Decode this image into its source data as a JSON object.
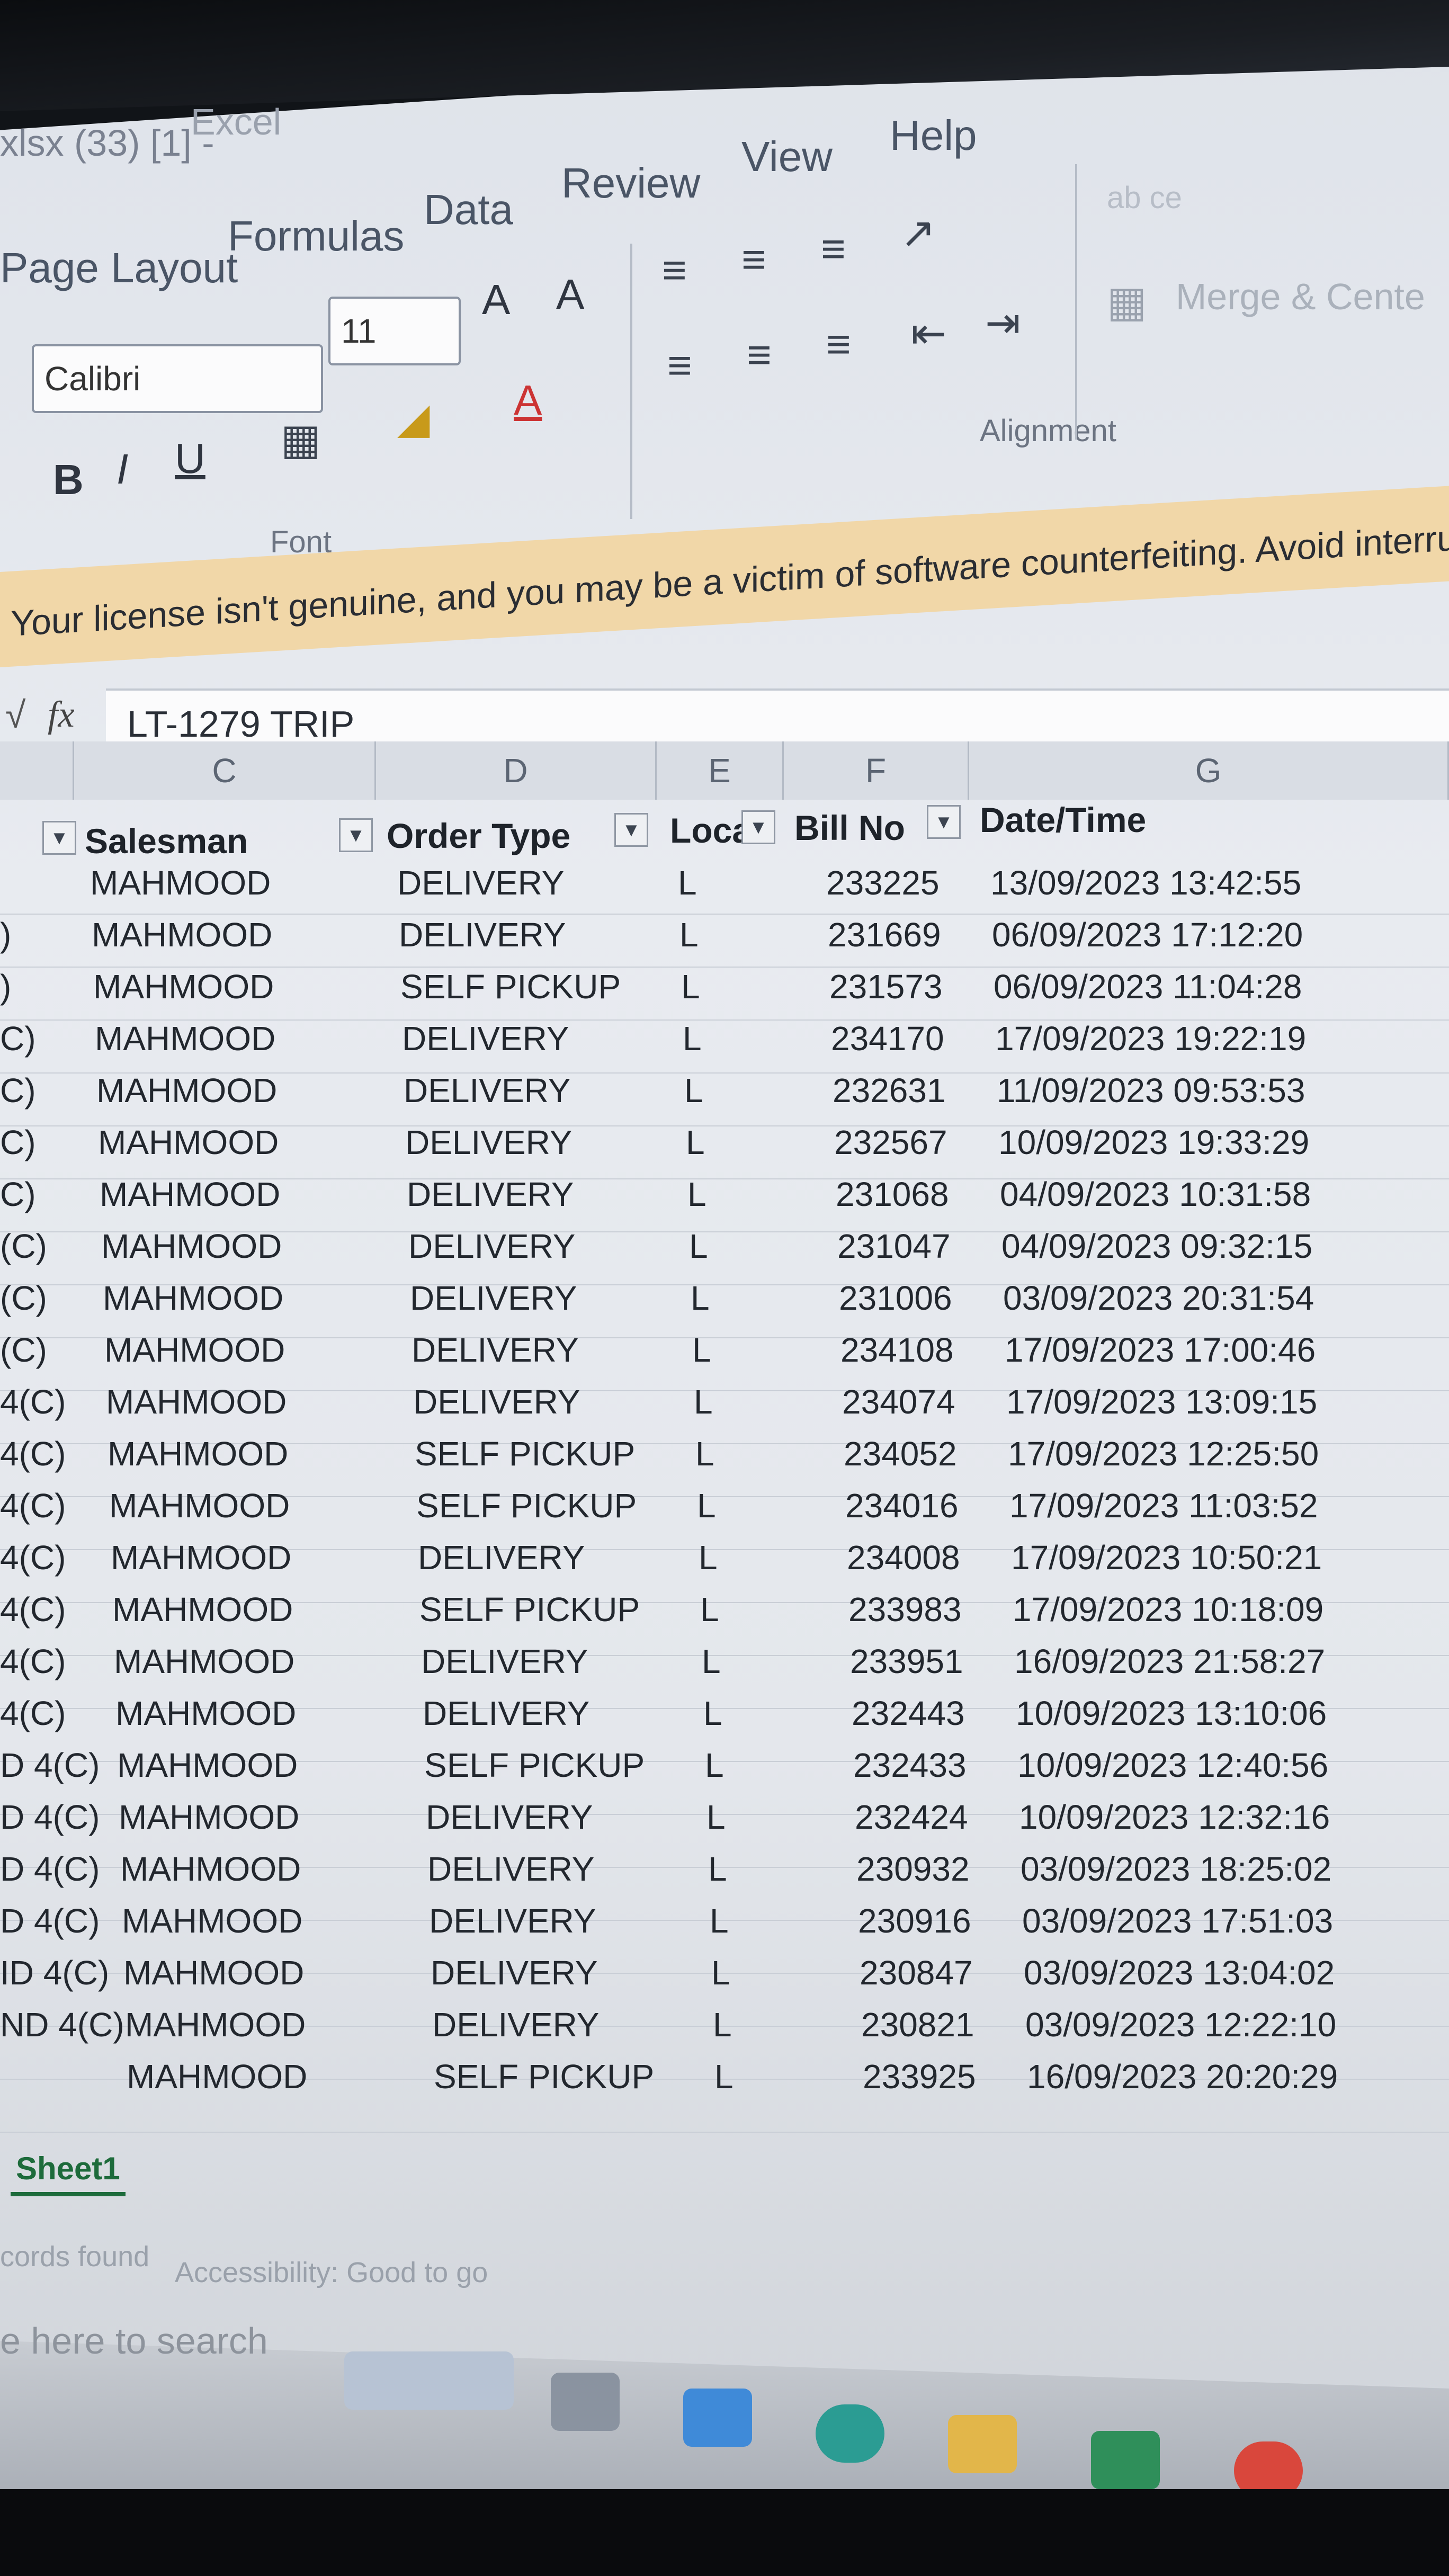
{
  "window": {
    "doc_title": "xlsx (33) [1] -",
    "app_name": "Excel"
  },
  "ribbon_tabs": [
    "Page Layout",
    "Formulas",
    "Data",
    "Review",
    "View",
    "Help"
  ],
  "font_group": {
    "font_name": "Calibri",
    "font_size": "11",
    "bold": "B",
    "italic": "I",
    "underline": "U",
    "grow": "A",
    "shrink": "A",
    "font_color_glyph": "A",
    "label": "Font"
  },
  "alignment_group": {
    "label": "Alignment",
    "merge": "Merge & Cente",
    "wrap": "ab ce"
  },
  "license_banner": "Your license isn't genuine, and you may be a victim of software counterfeiting. Avoid interrupt",
  "formula_bar": {
    "fx": "fx",
    "value": "LT-1279 TRIP"
  },
  "column_letters": [
    "C",
    "D",
    "E",
    "F",
    "G"
  ],
  "headers": {
    "salesman": "Salesman",
    "order_type": "Order Type",
    "location": "Loca",
    "bill_no": "Bill No",
    "datetime": "Date/Time"
  },
  "rows": [
    {
      "b": "",
      "salesman": "MAHMOOD",
      "type": "DELIVERY",
      "loc": "L",
      "bill": "233225",
      "dt": "13/09/2023 13:42:55"
    },
    {
      "b": ")",
      "salesman": "MAHMOOD",
      "type": "DELIVERY",
      "loc": "L",
      "bill": "231669",
      "dt": "06/09/2023 17:12:20"
    },
    {
      "b": ")",
      "salesman": "MAHMOOD",
      "type": "SELF PICKUP",
      "loc": "L",
      "bill": "231573",
      "dt": "06/09/2023 11:04:28"
    },
    {
      "b": "C)",
      "salesman": "MAHMOOD",
      "type": "DELIVERY",
      "loc": "L",
      "bill": "234170",
      "dt": "17/09/2023 19:22:19"
    },
    {
      "b": "C)",
      "salesman": "MAHMOOD",
      "type": "DELIVERY",
      "loc": "L",
      "bill": "232631",
      "dt": "11/09/2023 09:53:53"
    },
    {
      "b": "C)",
      "salesman": "MAHMOOD",
      "type": "DELIVERY",
      "loc": "L",
      "bill": "232567",
      "dt": "10/09/2023 19:33:29"
    },
    {
      "b": "C)",
      "salesman": "MAHMOOD",
      "type": "DELIVERY",
      "loc": "L",
      "bill": "231068",
      "dt": "04/09/2023 10:31:58"
    },
    {
      "b": "(C)",
      "salesman": "MAHMOOD",
      "type": "DELIVERY",
      "loc": "L",
      "bill": "231047",
      "dt": "04/09/2023 09:32:15"
    },
    {
      "b": "(C)",
      "salesman": "MAHMOOD",
      "type": "DELIVERY",
      "loc": "L",
      "bill": "231006",
      "dt": "03/09/2023 20:31:54"
    },
    {
      "b": "(C)",
      "salesman": "MAHMOOD",
      "type": "DELIVERY",
      "loc": "L",
      "bill": "234108",
      "dt": "17/09/2023 17:00:46"
    },
    {
      "b": "4(C)",
      "salesman": "MAHMOOD",
      "type": "DELIVERY",
      "loc": "L",
      "bill": "234074",
      "dt": "17/09/2023 13:09:15"
    },
    {
      "b": "4(C)",
      "salesman": "MAHMOOD",
      "type": "SELF PICKUP",
      "loc": "L",
      "bill": "234052",
      "dt": "17/09/2023 12:25:50"
    },
    {
      "b": "4(C)",
      "salesman": "MAHMOOD",
      "type": "SELF PICKUP",
      "loc": "L",
      "bill": "234016",
      "dt": "17/09/2023 11:03:52"
    },
    {
      "b": "4(C)",
      "salesman": "MAHMOOD",
      "type": "DELIVERY",
      "loc": "L",
      "bill": "234008",
      "dt": "17/09/2023 10:50:21"
    },
    {
      "b": "4(C)",
      "salesman": "MAHMOOD",
      "type": "SELF PICKUP",
      "loc": "L",
      "bill": "233983",
      "dt": "17/09/2023 10:18:09"
    },
    {
      "b": "4(C)",
      "salesman": "MAHMOOD",
      "type": "DELIVERY",
      "loc": "L",
      "bill": "233951",
      "dt": "16/09/2023 21:58:27"
    },
    {
      "b": "4(C)",
      "salesman": "MAHMOOD",
      "type": "DELIVERY",
      "loc": "L",
      "bill": "232443",
      "dt": "10/09/2023 13:10:06"
    },
    {
      "b": "D 4(C)",
      "salesman": "MAHMOOD",
      "type": "SELF PICKUP",
      "loc": "L",
      "bill": "232433",
      "dt": "10/09/2023 12:40:56"
    },
    {
      "b": "D 4(C)",
      "salesman": "MAHMOOD",
      "type": "DELIVERY",
      "loc": "L",
      "bill": "232424",
      "dt": "10/09/2023 12:32:16"
    },
    {
      "b": "D 4(C)",
      "salesman": "MAHMOOD",
      "type": "DELIVERY",
      "loc": "L",
      "bill": "230932",
      "dt": "03/09/2023 18:25:02"
    },
    {
      "b": "D 4(C)",
      "salesman": "MAHMOOD",
      "type": "DELIVERY",
      "loc": "L",
      "bill": "230916",
      "dt": "03/09/2023 17:51:03"
    },
    {
      "b": "ID 4(C)",
      "salesman": "MAHMOOD",
      "type": "DELIVERY",
      "loc": "L",
      "bill": "230847",
      "dt": "03/09/2023 13:04:02"
    },
    {
      "b": "ND 4(C)",
      "salesman": "MAHMOOD",
      "type": "DELIVERY",
      "loc": "L",
      "bill": "230821",
      "dt": "03/09/2023 12:22:10"
    },
    {
      "b": "",
      "salesman": "MAHMOOD",
      "type": "SELF PICKUP",
      "loc": "L",
      "bill": "233925",
      "dt": "16/09/2023 20:20:29"
    }
  ],
  "sheet_tab": "Sheet1",
  "status": {
    "records": "cords found",
    "accessibility": "Accessibility: Good to go"
  },
  "taskbar": {
    "search_placeholder": "e here to search"
  }
}
